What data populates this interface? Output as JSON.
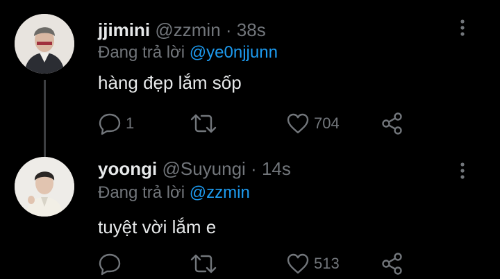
{
  "tweets": [
    {
      "name": "jjimini",
      "handle": "@zzmin",
      "dot": "·",
      "time": "38s",
      "reply_prefix": "Đang trả lời",
      "reply_to": "@ye0njjunn",
      "text": "hàng đẹp lắm sốp",
      "reply_count": "1",
      "retweet_count": "",
      "like_count": "704"
    },
    {
      "name": "yoongi",
      "handle": "@Suyungi",
      "dot": "·",
      "time": "14s",
      "reply_prefix": "Đang trả lời",
      "reply_to": "@zzmin",
      "text": "tuyệt vời lắm e",
      "reply_count": "",
      "retweet_count": "",
      "like_count": "513"
    }
  ],
  "icons": [
    "more-vertical-icon",
    "reply-icon",
    "retweet-icon",
    "like-icon",
    "share-icon"
  ],
  "colors": {
    "background": "#000000",
    "text": "#e7e9ea",
    "muted": "#72767b",
    "accent": "#1d9bf0"
  }
}
